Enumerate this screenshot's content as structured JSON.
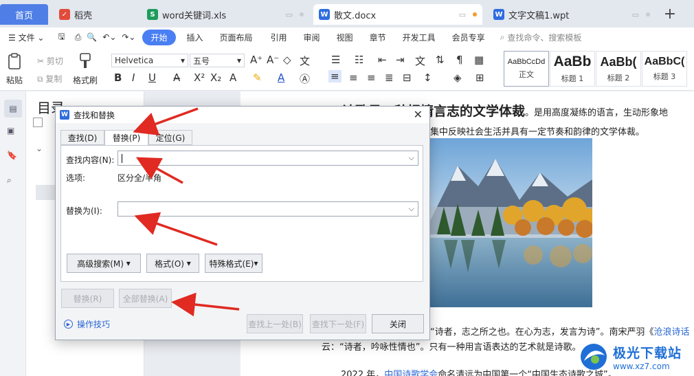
{
  "tabs": {
    "home": "首页",
    "items": [
      {
        "label": "稻壳",
        "icon": "daoke-icon",
        "color": "#e24b3b"
      },
      {
        "label": "word关键词.xls",
        "icon": "spreadsheet-icon",
        "color": "#1d9c5b"
      },
      {
        "label": "散文.docx",
        "icon": "word-doc-icon",
        "color": "#2f6de0"
      },
      {
        "label": "文字文稿1.wpt",
        "icon": "word-doc-icon",
        "color": "#2f6de0"
      }
    ]
  },
  "menubar": {
    "items": [
      "文件",
      "开始",
      "插入",
      "页面布局",
      "引用",
      "审阅",
      "视图",
      "章节",
      "开发工具",
      "会员专享"
    ],
    "search": "查找命令、搜索模板"
  },
  "ribbon": {
    "paste": "粘贴",
    "cut": "剪切",
    "copy": "复制",
    "format_painter": "格式刷",
    "font": "Helvetica",
    "size": "五号",
    "styles": [
      {
        "sample": "AaBbCcDd",
        "name": "正文"
      },
      {
        "sample": "AaBb",
        "name": "标题 1"
      },
      {
        "sample": "AaBb(",
        "name": "标题 2"
      },
      {
        "sample": "AaBbC(",
        "name": "标题 3"
      }
    ]
  },
  "nav": {
    "title": "目录"
  },
  "document": {
    "heading": "诗歌是一种抒情言志的文学体裁",
    "heading_tail": "。是用高度凝练的语言，生动形象地",
    "line2": "集中反映社会生活并具有一定节奏和韵律的文学体裁。",
    "line3_a": "“诗者，志之所之也。在心为志，发言为诗”。南宋严羽《",
    "line3_link": "沧浪诗话",
    "line4": "云：“诗者，吟咏性情也”。只有一种用言语表达的艺术就是诗歌。",
    "line5_a": "2022 年，",
    "line5_link": "中国诗歌学会",
    "line5_b": "命名清远为中国第一个“中国生态诗歌之城”。"
  },
  "dialog": {
    "title": "查找和替换",
    "tabs": [
      "查找(D)",
      "替换(P)",
      "定位(G)"
    ],
    "find_label": "查找内容(N):",
    "find_value": "",
    "options_label": "选项:",
    "options_value": "区分全/半角",
    "replace_label": "替换为(I):",
    "replace_value": "",
    "advanced": "高级搜索(M)",
    "format": "格式(O)",
    "special": "特殊格式(E)",
    "replace_btn": "替换(R)",
    "replace_all_btn": "全部替换(A)",
    "prev_btn": "查找上一处(B)",
    "next_btn": "查找下一处(F)",
    "close_btn": "关闭",
    "tips": "操作技巧"
  },
  "watermark": {
    "text": "极光下载站",
    "url": "www.xz7.com"
  }
}
